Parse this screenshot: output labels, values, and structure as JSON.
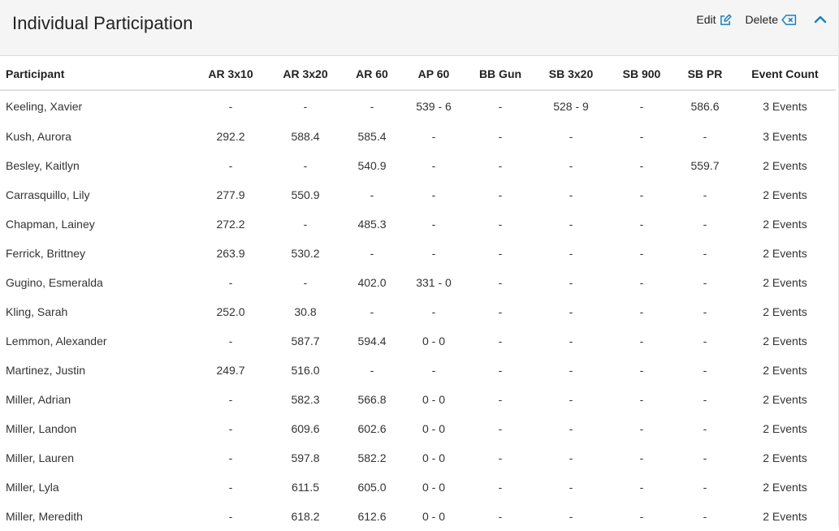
{
  "title": "Individual Participation",
  "actions": {
    "edit_label": "Edit",
    "delete_label": "Delete"
  },
  "colors": {
    "accent": "#1a7fbf"
  },
  "icons": {
    "edit": "edit-icon",
    "delete": "backspace-icon",
    "collapse": "chevron-up-icon"
  },
  "table": {
    "columns": [
      "Participant",
      "AR 3x10",
      "AR 3x20",
      "AR 60",
      "AP 60",
      "BB Gun",
      "SB 3x20",
      "SB 900",
      "SB PR",
      "Event Count"
    ],
    "rows": [
      [
        "Keeling, Xavier",
        "-",
        "-",
        "-",
        "539 - 6",
        "-",
        "528 - 9",
        "-",
        "586.6",
        "3 Events"
      ],
      [
        "Kush, Aurora",
        "292.2",
        "588.4",
        "585.4",
        "-",
        "-",
        "-",
        "-",
        "-",
        "3 Events"
      ],
      [
        "Besley, Kaitlyn",
        "-",
        "-",
        "540.9",
        "-",
        "-",
        "-",
        "-",
        "559.7",
        "2 Events"
      ],
      [
        "Carrasquillo, Lily",
        "277.9",
        "550.9",
        "-",
        "-",
        "-",
        "-",
        "-",
        "-",
        "2 Events"
      ],
      [
        "Chapman, Lainey",
        "272.2",
        "-",
        "485.3",
        "-",
        "-",
        "-",
        "-",
        "-",
        "2 Events"
      ],
      [
        "Ferrick, Brittney",
        "263.9",
        "530.2",
        "-",
        "-",
        "-",
        "-",
        "-",
        "-",
        "2 Events"
      ],
      [
        "Gugino, Esmeralda",
        "-",
        "-",
        "402.0",
        "331 - 0",
        "-",
        "-",
        "-",
        "-",
        "2 Events"
      ],
      [
        "Kling, Sarah",
        "252.0",
        "30.8",
        "-",
        "-",
        "-",
        "-",
        "-",
        "-",
        "2 Events"
      ],
      [
        "Lemmon, Alexander",
        "-",
        "587.7",
        "594.4",
        "0 - 0",
        "-",
        "-",
        "-",
        "-",
        "2 Events"
      ],
      [
        "Martinez, Justin",
        "249.7",
        "516.0",
        "-",
        "-",
        "-",
        "-",
        "-",
        "-",
        "2 Events"
      ],
      [
        "Miller, Adrian",
        "-",
        "582.3",
        "566.8",
        "0 - 0",
        "-",
        "-",
        "-",
        "-",
        "2 Events"
      ],
      [
        "Miller, Landon",
        "-",
        "609.6",
        "602.6",
        "0 - 0",
        "-",
        "-",
        "-",
        "-",
        "2 Events"
      ],
      [
        "Miller, Lauren",
        "-",
        "597.8",
        "582.2",
        "0 - 0",
        "-",
        "-",
        "-",
        "-",
        "2 Events"
      ],
      [
        "Miller, Lyla",
        "-",
        "611.5",
        "605.0",
        "0 - 0",
        "-",
        "-",
        "-",
        "-",
        "2 Events"
      ],
      [
        "Miller, Meredith",
        "-",
        "618.2",
        "612.6",
        "0 - 0",
        "-",
        "-",
        "-",
        "-",
        "2 Events"
      ]
    ]
  }
}
